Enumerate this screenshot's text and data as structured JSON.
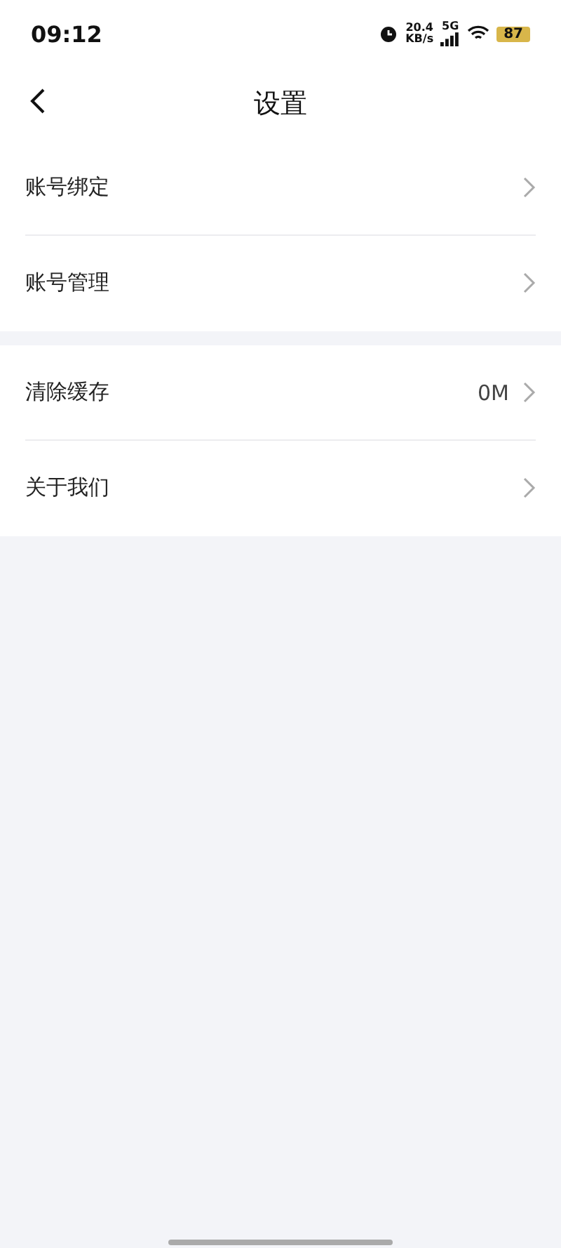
{
  "status_bar": {
    "time": "09:12",
    "speed": "20.4",
    "speed_unit": "KB/s",
    "network": "5G",
    "battery": "87"
  },
  "header": {
    "title": "设置"
  },
  "groups": [
    {
      "items": [
        {
          "label": "账号绑定"
        },
        {
          "label": "账号管理"
        }
      ]
    },
    {
      "items": [
        {
          "label": "清除缓存",
          "value": "0M"
        },
        {
          "label": "关于我们"
        }
      ]
    }
  ]
}
